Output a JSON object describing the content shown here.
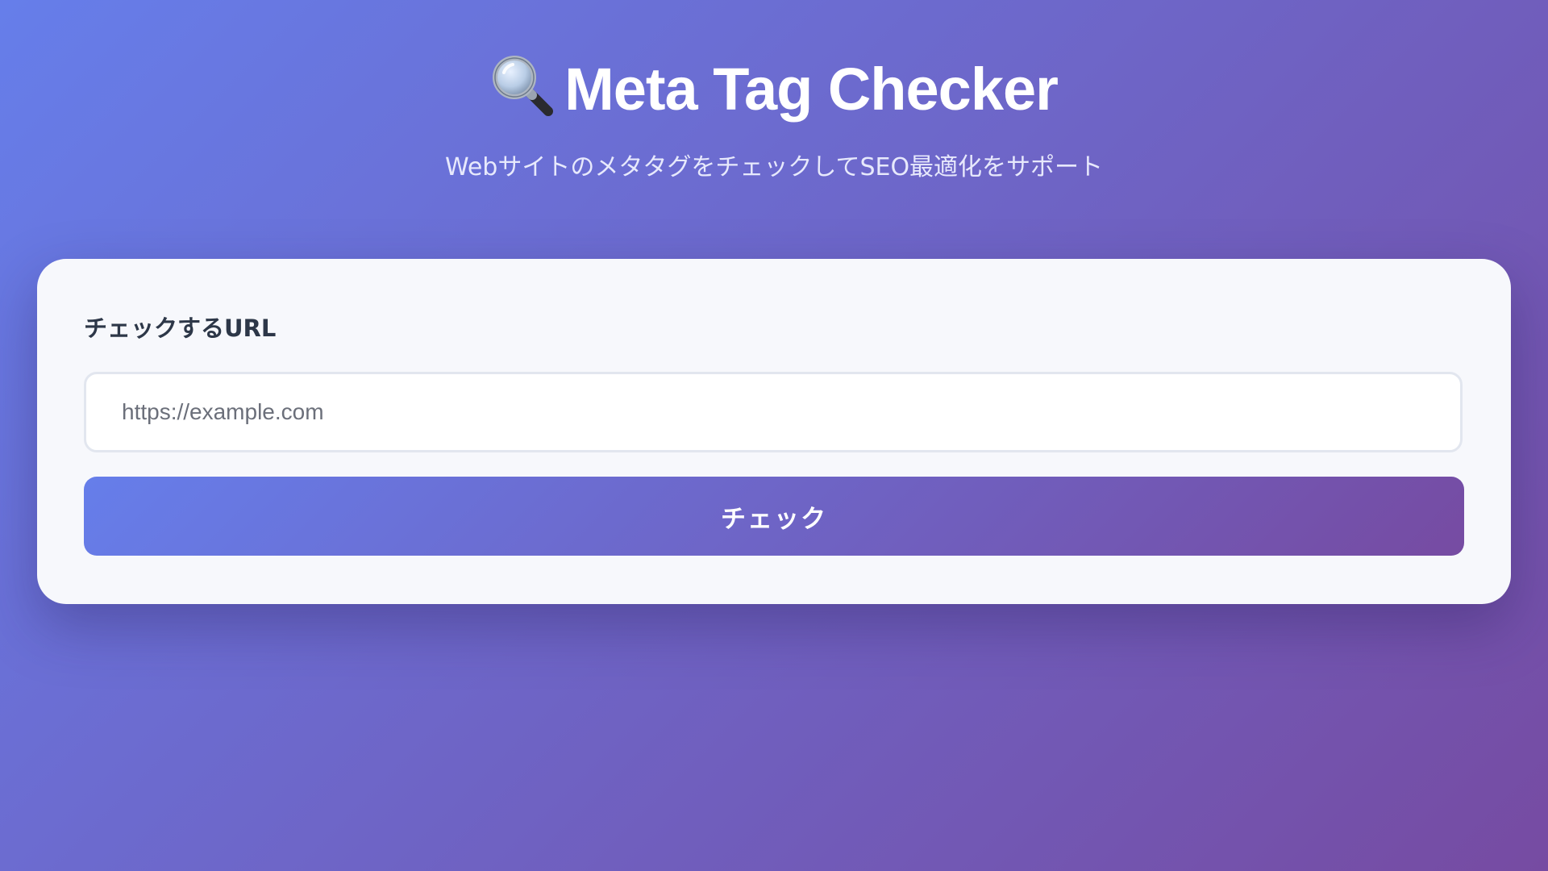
{
  "header": {
    "icon": "magnifying-glass-icon",
    "title": "Meta Tag Checker",
    "subtitle": "WebサイトのメタタグをチェックしてSEO最適化をサポート"
  },
  "form": {
    "label": "チェックするURL",
    "url_input": {
      "value": "",
      "placeholder": "https://example.com"
    },
    "submit_label": "チェック"
  },
  "colors": {
    "gradient_start": "#667eea",
    "gradient_end": "#764ba2",
    "card_background": "#f7f8fc",
    "label_text": "#2d3748"
  }
}
